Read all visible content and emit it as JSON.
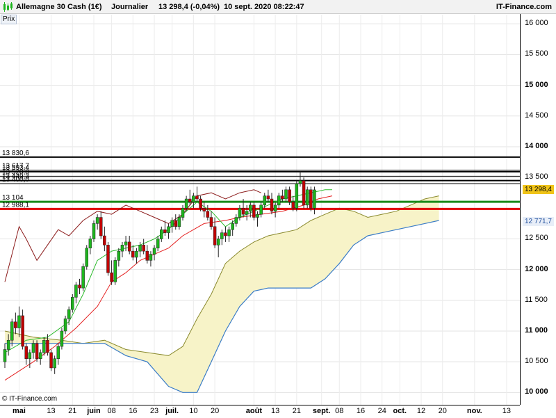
{
  "header": {
    "title": "Allemagne 30 Cash (1€)",
    "period": "Journalier",
    "quote": "13 298,4 (-0,04%)",
    "datetime": "10 sept. 2020 08:22:47",
    "brand": "IT-Finance.com"
  },
  "panel_label": "Prix",
  "copyright": "© IT-Finance.com",
  "colors": {
    "background": "#ffffff",
    "candle_up": "#1db51d",
    "candle_down": "#c00000",
    "kumo_fill": "#f7f3c8",
    "senkou_a": "#8a8a2e",
    "senkou_b": "#3a7cc7",
    "tenkan": "#2bbb2b",
    "kijun": "#e42020",
    "chikou": "#8b1a1a",
    "green_level": "#198a19",
    "red_level": "#e00000",
    "current_tag": "#f0c419"
  },
  "chart_data": {
    "type": "candlestick",
    "title": "Allemagne 30 Cash (1€)",
    "ylim": [
      9800,
      16150
    ],
    "y_ticks": [
      {
        "v": 16000,
        "label": "16 000",
        "bold": false
      },
      {
        "v": 15500,
        "label": "15 500",
        "bold": false
      },
      {
        "v": 15000,
        "label": "15 000",
        "bold": true
      },
      {
        "v": 14500,
        "label": "14 500",
        "bold": false
      },
      {
        "v": 14000,
        "label": "14 000",
        "bold": true
      },
      {
        "v": 13500,
        "label": "13 500",
        "bold": false
      },
      {
        "v": 12500,
        "label": "12 500",
        "bold": false
      },
      {
        "v": 12000,
        "label": "12 000",
        "bold": true
      },
      {
        "v": 11500,
        "label": "11 500",
        "bold": false
      },
      {
        "v": 11000,
        "label": "11 000",
        "bold": true
      },
      {
        "v": 10500,
        "label": "10 500",
        "bold": false
      },
      {
        "v": 10000,
        "label": "10 000",
        "bold": true
      }
    ],
    "x_ticks": [
      {
        "i": 4,
        "label": "mai",
        "bold": true
      },
      {
        "i": 13,
        "label": "13",
        "bold": false
      },
      {
        "i": 19,
        "label": "21",
        "bold": false
      },
      {
        "i": 25,
        "label": "juin",
        "bold": true
      },
      {
        "i": 30,
        "label": "08",
        "bold": false
      },
      {
        "i": 36,
        "label": "16",
        "bold": false
      },
      {
        "i": 42,
        "label": "23",
        "bold": false
      },
      {
        "i": 47,
        "label": "juil.",
        "bold": true
      },
      {
        "i": 53,
        "label": "10",
        "bold": false
      },
      {
        "i": 59,
        "label": "20",
        "bold": false
      },
      {
        "i": 70,
        "label": "août",
        "bold": true
      },
      {
        "i": 76,
        "label": "13",
        "bold": false
      },
      {
        "i": 82,
        "label": "21",
        "bold": false
      },
      {
        "i": 89,
        "label": "sept.",
        "bold": true
      },
      {
        "i": 94,
        "label": "08",
        "bold": false
      },
      {
        "i": 100,
        "label": "16",
        "bold": false
      },
      {
        "i": 106,
        "label": "24",
        "bold": false
      },
      {
        "i": 111,
        "label": "oct.",
        "bold": true
      },
      {
        "i": 117,
        "label": "12",
        "bold": false
      },
      {
        "i": 123,
        "label": "20",
        "bold": false
      },
      {
        "i": 132,
        "label": "nov.",
        "bold": true
      },
      {
        "i": 141,
        "label": "13",
        "bold": false
      }
    ],
    "levels": [
      {
        "value": 13830.6,
        "label": "13 830,6",
        "color": "#000000",
        "width": 2
      },
      {
        "value": 13617.7,
        "label": "13 617,7",
        "color": "#000000",
        "width": 1
      },
      {
        "value": 13593.4,
        "label": "13 593,4",
        "color": "#000000",
        "width": 2
      },
      {
        "value": 13520.0,
        "label": "13 520,0",
        "color": "#000000",
        "width": 1
      },
      {
        "value": 13449.3,
        "label": "13 449,3",
        "color": "#000000",
        "width": 2
      },
      {
        "value": 13400.0,
        "label": "13 400,0",
        "color": "#000000",
        "width": 1
      },
      {
        "value": 13104.0,
        "label": "13 104",
        "color": "#198a19",
        "width": 3
      },
      {
        "value": 12988.1,
        "label": "12 988,1",
        "color": "#e00000",
        "width": 3
      }
    ],
    "right_tags": [
      {
        "value": 13298.4,
        "label": "13 298,4",
        "bg": "#f0c419",
        "color": "#000000"
      },
      {
        "value": 12771.7,
        "label": "12 771,7",
        "bg": "#e8eef8",
        "color": "#1f4e9c"
      }
    ],
    "candles": [
      [
        10500,
        10800,
        10400,
        10700
      ],
      [
        10700,
        10950,
        10600,
        10850
      ],
      [
        10850,
        11200,
        10750,
        11150
      ],
      [
        11150,
        11300,
        10950,
        11050
      ],
      [
        11050,
        11400,
        10900,
        11250
      ],
      [
        11250,
        11350,
        10700,
        10750
      ],
      [
        10750,
        10800,
        10450,
        10550
      ],
      [
        10550,
        10700,
        10400,
        10650
      ],
      [
        10650,
        10850,
        10550,
        10800
      ],
      [
        10800,
        10850,
        10500,
        10550
      ],
      [
        10550,
        10700,
        10450,
        10650
      ],
      [
        10650,
        10900,
        10600,
        10850
      ],
      [
        10850,
        10950,
        10600,
        10650
      ],
      [
        10650,
        10700,
        10350,
        10400
      ],
      [
        10400,
        10600,
        10300,
        10550
      ],
      [
        10550,
        10800,
        10450,
        10750
      ],
      [
        10750,
        11050,
        10700,
        11000
      ],
      [
        11000,
        11250,
        10950,
        11200
      ],
      [
        11200,
        11400,
        11100,
        11350
      ],
      [
        11350,
        11600,
        11300,
        11550
      ],
      [
        11550,
        11800,
        11450,
        11750
      ],
      [
        11750,
        11850,
        11600,
        11700
      ],
      [
        11700,
        12100,
        11650,
        12050
      ],
      [
        12050,
        12400,
        12000,
        12350
      ],
      [
        12350,
        12550,
        12250,
        12500
      ],
      [
        12500,
        12800,
        12450,
        12750
      ],
      [
        12750,
        12900,
        12650,
        12850
      ],
      [
        12850,
        12950,
        12500,
        12550
      ],
      [
        12550,
        12700,
        12300,
        12400
      ],
      [
        12400,
        12450,
        11900,
        11950
      ],
      [
        11950,
        12150,
        11750,
        11800
      ],
      [
        11800,
        12200,
        11750,
        12150
      ],
      [
        12150,
        12350,
        12050,
        12300
      ],
      [
        12300,
        12450,
        12200,
        12400
      ],
      [
        12400,
        12550,
        12300,
        12450
      ],
      [
        12450,
        12550,
        12250,
        12300
      ],
      [
        12300,
        12400,
        12150,
        12200
      ],
      [
        12200,
        12350,
        12100,
        12300
      ],
      [
        12300,
        12450,
        12200,
        12400
      ],
      [
        12400,
        12500,
        12250,
        12300
      ],
      [
        12300,
        12400,
        12100,
        12150
      ],
      [
        12150,
        12300,
        12050,
        12250
      ],
      [
        12250,
        12400,
        12150,
        12350
      ],
      [
        12350,
        12550,
        12300,
        12500
      ],
      [
        12500,
        12700,
        12450,
        12650
      ],
      [
        12650,
        12800,
        12550,
        12600
      ],
      [
        12600,
        12750,
        12500,
        12700
      ],
      [
        12700,
        12850,
        12600,
        12800
      ],
      [
        12800,
        12900,
        12650,
        12700
      ],
      [
        12700,
        12900,
        12650,
        12850
      ],
      [
        12850,
        13050,
        12800,
        13000
      ],
      [
        13000,
        13200,
        12950,
        13150
      ],
      [
        13150,
        13300,
        13050,
        13100
      ],
      [
        13100,
        13250,
        13000,
        13200
      ],
      [
        13200,
        13350,
        13100,
        13150
      ],
      [
        13150,
        13200,
        12950,
        13000
      ],
      [
        13000,
        13100,
        12850,
        12950
      ],
      [
        12950,
        13050,
        12800,
        12850
      ],
      [
        12850,
        12950,
        12650,
        12700
      ],
      [
        12700,
        12850,
        12350,
        12400
      ],
      [
        12400,
        12550,
        12200,
        12500
      ],
      [
        12500,
        12650,
        12400,
        12600
      ],
      [
        12600,
        12700,
        12450,
        12550
      ],
      [
        12550,
        12700,
        12450,
        12650
      ],
      [
        12650,
        12800,
        12550,
        12750
      ],
      [
        12750,
        12900,
        12700,
        12850
      ],
      [
        12850,
        13050,
        12800,
        13000
      ],
      [
        13000,
        13150,
        12850,
        12900
      ],
      [
        12900,
        13050,
        12800,
        12950
      ],
      [
        12950,
        13100,
        12850,
        13050
      ],
      [
        13050,
        13100,
        12800,
        12850
      ],
      [
        12850,
        12950,
        12700,
        12900
      ],
      [
        12900,
        13100,
        12850,
        13050
      ],
      [
        13050,
        13250,
        13000,
        13200
      ],
      [
        13200,
        13300,
        13100,
        13150
      ],
      [
        13150,
        13250,
        12900,
        12950
      ],
      [
        12950,
        13100,
        12850,
        13050
      ],
      [
        13050,
        13250,
        13000,
        13200
      ],
      [
        13200,
        13300,
        13100,
        13150
      ],
      [
        13150,
        13350,
        13100,
        13300
      ],
      [
        13300,
        13350,
        13050,
        13100
      ],
      [
        13100,
        13200,
        12950,
        13000
      ],
      [
        13000,
        13450,
        12950,
        13400
      ],
      [
        13400,
        13600,
        13350,
        13450
      ],
      [
        13450,
        13500,
        13000,
        13050
      ],
      [
        13050,
        13350,
        13000,
        13300
      ],
      [
        13300,
        13350,
        12950,
        13000
      ],
      [
        13000,
        13350,
        12900,
        13298.4
      ]
    ],
    "tenkan": [
      [
        0,
        10650
      ],
      [
        6,
        10850
      ],
      [
        12,
        10900
      ],
      [
        18,
        11150
      ],
      [
        22,
        11600
      ],
      [
        26,
        12150
      ],
      [
        30,
        12300
      ],
      [
        34,
        12350
      ],
      [
        38,
        12400
      ],
      [
        42,
        12500
      ],
      [
        46,
        12650
      ],
      [
        50,
        12900
      ],
      [
        54,
        13100
      ],
      [
        58,
        12950
      ],
      [
        62,
        12700
      ],
      [
        66,
        12850
      ],
      [
        70,
        12950
      ],
      [
        74,
        13050
      ],
      [
        78,
        13150
      ],
      [
        82,
        13200
      ],
      [
        86,
        13250
      ],
      [
        90,
        13300
      ],
      [
        92,
        13300
      ]
    ],
    "kijun": [
      [
        0,
        10200
      ],
      [
        8,
        10500
      ],
      [
        14,
        10750
      ],
      [
        20,
        11050
      ],
      [
        26,
        11400
      ],
      [
        30,
        11800
      ],
      [
        34,
        11950
      ],
      [
        38,
        12150
      ],
      [
        42,
        12250
      ],
      [
        46,
        12350
      ],
      [
        50,
        12550
      ],
      [
        56,
        12750
      ],
      [
        62,
        12800
      ],
      [
        66,
        12850
      ],
      [
        72,
        12900
      ],
      [
        78,
        12950
      ],
      [
        84,
        13050
      ],
      [
        88,
        13150
      ],
      [
        92,
        13200
      ]
    ],
    "chikou": [
      [
        0,
        11800
      ],
      [
        4,
        12700
      ],
      [
        6,
        12500
      ],
      [
        9,
        12150
      ],
      [
        12,
        12400
      ],
      [
        15,
        12650
      ],
      [
        18,
        12550
      ],
      [
        22,
        12800
      ],
      [
        26,
        12950
      ],
      [
        30,
        12900
      ],
      [
        34,
        13050
      ],
      [
        38,
        12950
      ],
      [
        42,
        12850
      ],
      [
        46,
        12750
      ],
      [
        50,
        12900
      ],
      [
        54,
        13200
      ],
      [
        58,
        13250
      ],
      [
        62,
        13150
      ],
      [
        66,
        13250
      ],
      [
        70,
        13300
      ],
      [
        72,
        13250
      ]
    ],
    "senkou_a": [
      [
        0,
        11000
      ],
      [
        8,
        10900
      ],
      [
        16,
        10850
      ],
      [
        22,
        10800
      ],
      [
        28,
        10850
      ],
      [
        34,
        10700
      ],
      [
        40,
        10650
      ],
      [
        46,
        10600
      ],
      [
        50,
        10750
      ],
      [
        54,
        11200
      ],
      [
        58,
        11600
      ],
      [
        62,
        12100
      ],
      [
        66,
        12300
      ],
      [
        70,
        12450
      ],
      [
        74,
        12550
      ],
      [
        78,
        12600
      ],
      [
        82,
        12650
      ],
      [
        86,
        12800
      ],
      [
        90,
        12900
      ],
      [
        94,
        13000
      ],
      [
        98,
        12950
      ],
      [
        102,
        12850
      ],
      [
        106,
        12900
      ],
      [
        110,
        12950
      ],
      [
        114,
        13050
      ],
      [
        118,
        13150
      ],
      [
        122,
        13200
      ]
    ],
    "senkou_b": [
      [
        0,
        10800
      ],
      [
        8,
        10800
      ],
      [
        16,
        10800
      ],
      [
        22,
        10800
      ],
      [
        28,
        10800
      ],
      [
        34,
        10600
      ],
      [
        40,
        10500
      ],
      [
        46,
        10100
      ],
      [
        50,
        10000
      ],
      [
        54,
        10000
      ],
      [
        58,
        10500
      ],
      [
        62,
        11000
      ],
      [
        66,
        11400
      ],
      [
        70,
        11650
      ],
      [
        74,
        11700
      ],
      [
        78,
        11700
      ],
      [
        82,
        11700
      ],
      [
        86,
        11700
      ],
      [
        90,
        11850
      ],
      [
        94,
        12100
      ],
      [
        98,
        12400
      ],
      [
        102,
        12550
      ],
      [
        106,
        12600
      ],
      [
        110,
        12650
      ],
      [
        114,
        12700
      ],
      [
        118,
        12750
      ],
      [
        122,
        12800
      ]
    ]
  }
}
